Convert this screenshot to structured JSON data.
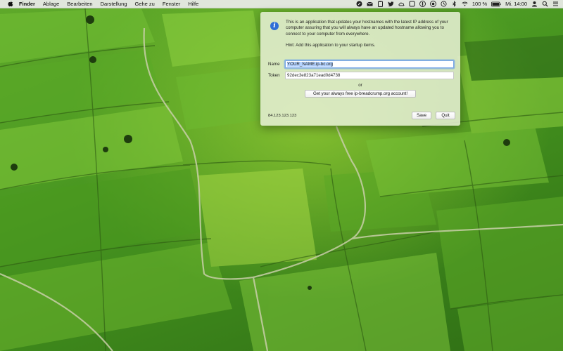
{
  "menubar": {
    "items": [
      "Finder",
      "Ablage",
      "Bearbeiten",
      "Darstellung",
      "Gehe zu",
      "Fenster",
      "Hilfe"
    ],
    "battery": "100 %",
    "clock": "Mi. 14:00",
    "status_icons": [
      "app-status-icon",
      "mail-icon",
      "clipboard-icon",
      "twitter-icon",
      "cloud-icon",
      "box-icon",
      "lock-icon",
      "record-icon",
      "time-machine-icon",
      "bluetooth-icon",
      "wifi-icon",
      "battery-icon",
      "user-icon",
      "spotlight-icon",
      "notification-center-icon"
    ]
  },
  "dialog": {
    "description": "This is an application that updates your hostnames with the latest IP address of your computer assuring that you will always have an updated hostname allowing you to connect to your computer from everywhere.",
    "hint": "Hint: Add this application to your startup items.",
    "name_label": "Name",
    "name_value": "YOUR_NAME.ip-bc.org",
    "token_label": "Token",
    "token_value": "92dec3e823a71ead0d4738",
    "or_label": "or",
    "account_button": "Get your always free ip-breadcrump.org account!",
    "ip_address": "84.123.123.123",
    "save_button": "Save",
    "quit_button": "Quit"
  },
  "colors": {
    "accent": "#2f6fd6",
    "panel_bg": "#e8f0d6",
    "field_focus": "#7aa7e6"
  }
}
